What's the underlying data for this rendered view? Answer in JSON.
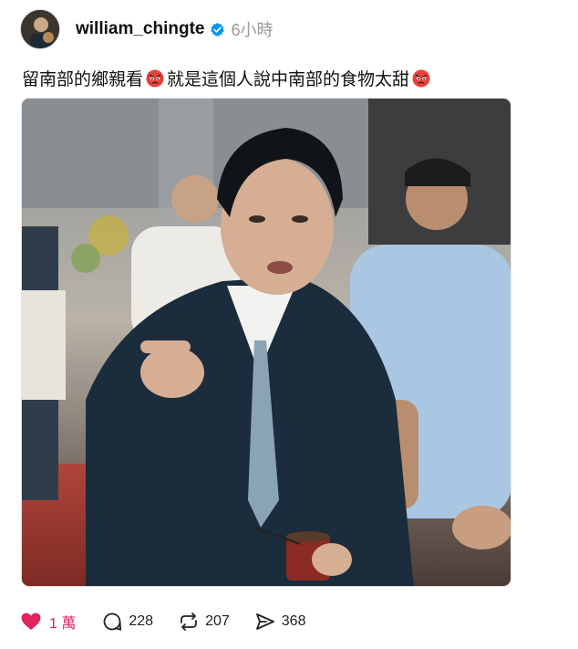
{
  "post": {
    "username": "william_chingte",
    "time": "6小時",
    "caption_part1": "留南部的鄉親看",
    "caption_part2": "就是這個人說中南部的食物太甜",
    "emoji": "angry-face-emoji"
  },
  "actions": {
    "likes": "1 萬",
    "replies": "228",
    "reposts": "207",
    "shares": "368"
  },
  "colors": {
    "like": "#e0245e",
    "verified": "#0095f6",
    "muted": "#999999"
  }
}
